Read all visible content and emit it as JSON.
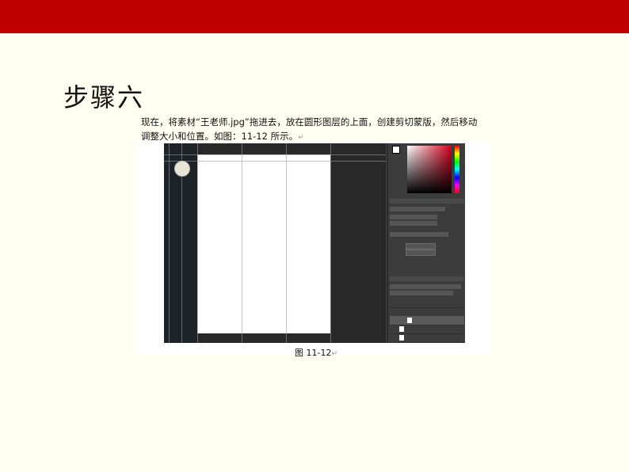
{
  "header": {
    "color": "#c00000"
  },
  "slide": {
    "title": "步骤六",
    "line1": "现在，将素材“王老师.jpg”拖进去，放在圆形图层的上面，创建剪切蒙版，然后移动",
    "line2": "调整大小和位置。如图：11-12 所示。",
    "return_mark": "↵",
    "caption": "图 11-12"
  }
}
